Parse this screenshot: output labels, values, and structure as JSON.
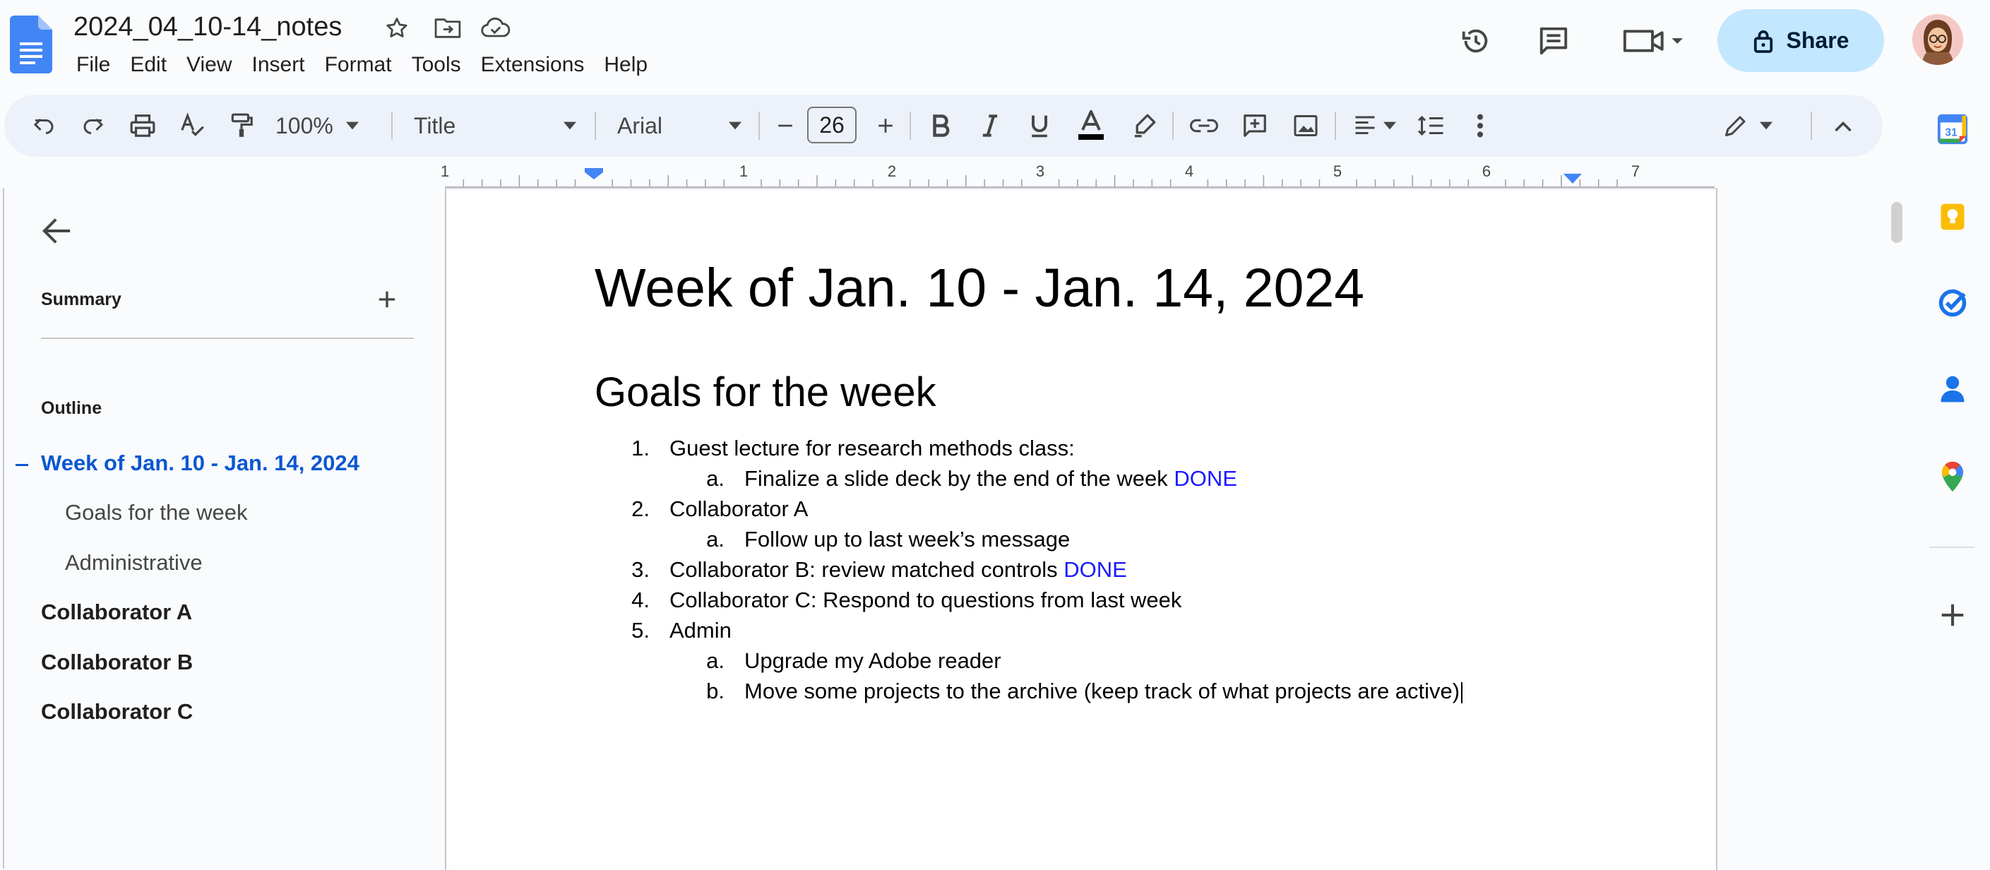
{
  "header": {
    "doc_title": "2024_04_10-14_notes",
    "menu": [
      "File",
      "Edit",
      "View",
      "Insert",
      "Format",
      "Tools",
      "Extensions",
      "Help"
    ],
    "share_label": "Share",
    "icons": [
      "docs-logo-icon",
      "star-icon",
      "move-folder-icon",
      "cloud-saved-icon",
      "version-history-icon",
      "comments-icon",
      "meet-icon",
      "lock-icon"
    ]
  },
  "toolbar": {
    "zoom": "100%",
    "style": "Title",
    "font": "Arial",
    "font_size": "26",
    "text_color": "#000000"
  },
  "ruler": {
    "labels": [
      "1",
      "1",
      "2",
      "3",
      "4",
      "5",
      "6",
      "7"
    ]
  },
  "sidebar": {
    "summary_label": "Summary",
    "outline_label": "Outline",
    "outline": [
      {
        "label": "Week of Jan. 10 - Jan. 14, 2024",
        "active": true
      },
      {
        "label": "Goals for the week"
      },
      {
        "label": "Administrative"
      },
      {
        "label": "Collaborator A"
      },
      {
        "label": "Collaborator B"
      },
      {
        "label": "Collaborator C"
      }
    ]
  },
  "document": {
    "heading": "Week of Jan. 10 - Jan. 14, 2024",
    "subheading": "Goals for the week",
    "items": [
      {
        "num": "1.",
        "text": "Guest lecture for research methods class:",
        "done": ""
      },
      {
        "num": "a.",
        "text": "Finalize a slide deck by the end of the week ",
        "done": "DONE"
      },
      {
        "num": "2.",
        "text": "Collaborator A",
        "done": ""
      },
      {
        "num": "a.",
        "text": "Follow up to last week’s message",
        "done": ""
      },
      {
        "num": "3.",
        "text": "Collaborator B: review matched controls ",
        "done": "DONE"
      },
      {
        "num": "4.",
        "text": "Collaborator C: Respond to questions from last week",
        "done": ""
      },
      {
        "num": "5.",
        "text": "Admin",
        "done": ""
      },
      {
        "num": "a.",
        "text": "Upgrade my Adobe reader",
        "done": ""
      },
      {
        "num": "b.",
        "text": "Move some projects to the archive (keep track of what projects are active)",
        "done": ""
      }
    ],
    "done_color": "#1a1aff"
  },
  "side_panel": {
    "apps": [
      "calendar-icon",
      "keep-icon",
      "tasks-icon",
      "contacts-icon",
      "maps-icon",
      "add-icon"
    ],
    "calendar_day": "31"
  },
  "colors": {
    "accent": "#0b57d0",
    "share_bg": "#c2e7ff",
    "toolbar_bg": "#edf2fa"
  }
}
